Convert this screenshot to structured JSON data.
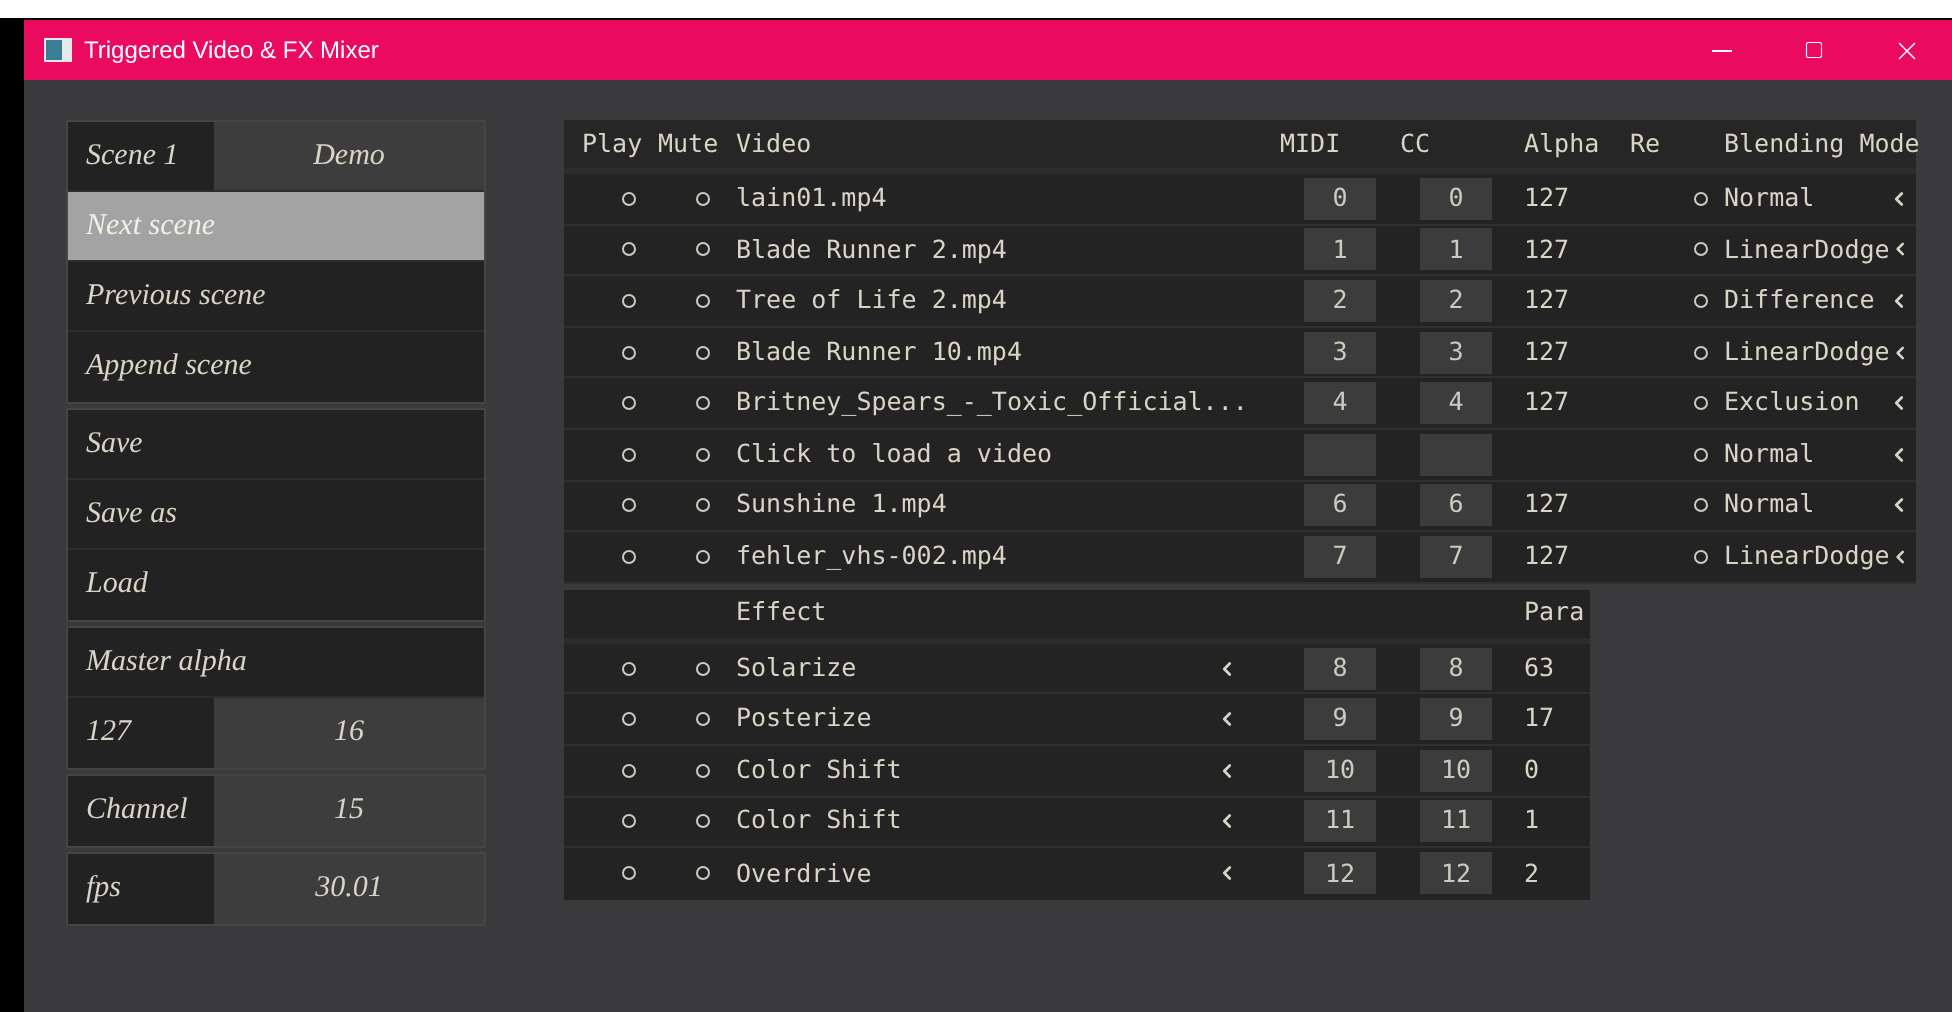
{
  "window": {
    "title": "Triggered Video & FX Mixer"
  },
  "scene_panel": {
    "groups": [
      {
        "items": [
          {
            "kind": "pair",
            "label": "Scene 1",
            "value": "Demo"
          },
          {
            "kind": "button",
            "label": "Next scene",
            "highlighted": true
          },
          {
            "kind": "button",
            "label": "Previous scene",
            "highlighted": false
          },
          {
            "kind": "button",
            "label": "Append scene",
            "highlighted": false
          }
        ]
      },
      {
        "items": [
          {
            "kind": "button",
            "label": "Save",
            "highlighted": false
          },
          {
            "kind": "button",
            "label": "Save as",
            "highlighted": false
          },
          {
            "kind": "button",
            "label": "Load",
            "highlighted": false
          }
        ]
      },
      {
        "items": [
          {
            "kind": "label",
            "label": "Master alpha"
          },
          {
            "kind": "pair",
            "label": "127",
            "value": "16"
          }
        ]
      },
      {
        "items": [
          {
            "kind": "pair",
            "label": "Channel",
            "value": "15"
          }
        ]
      },
      {
        "items": [
          {
            "kind": "pair",
            "label": "fps",
            "value": "30.01"
          }
        ]
      }
    ]
  },
  "video_table": {
    "columns": [
      "Play",
      "Mute",
      "Video",
      "MIDI",
      "CC",
      "Alpha",
      "Re",
      "Blending Mode"
    ],
    "rows": [
      {
        "playing": false,
        "muted": false,
        "video": "lain01.mp4",
        "midi": "0",
        "cc": "0",
        "alpha": "127",
        "re": false,
        "blend": "Normal"
      },
      {
        "playing": false,
        "muted": false,
        "video": "Blade Runner 2.mp4",
        "midi": "1",
        "cc": "1",
        "alpha": "127",
        "re": false,
        "blend": "LinearDodge"
      },
      {
        "playing": false,
        "muted": false,
        "video": "Tree of Life 2.mp4",
        "midi": "2",
        "cc": "2",
        "alpha": "127",
        "re": false,
        "blend": "Difference"
      },
      {
        "playing": false,
        "muted": false,
        "video": "Blade Runner 10.mp4",
        "midi": "3",
        "cc": "3",
        "alpha": "127",
        "re": false,
        "blend": "LinearDodge"
      },
      {
        "playing": false,
        "muted": false,
        "video": "Britney_Spears_-_Toxic_Official...",
        "midi": "4",
        "cc": "4",
        "alpha": "127",
        "re": false,
        "blend": "Exclusion"
      },
      {
        "playing": false,
        "muted": false,
        "video": "Click to load a video",
        "re": false,
        "blend": "Normal"
      },
      {
        "playing": false,
        "muted": false,
        "video": "Sunshine 1.mp4",
        "midi": "6",
        "cc": "6",
        "alpha": "127",
        "re": false,
        "blend": "Normal"
      },
      {
        "playing": false,
        "muted": false,
        "video": "fehler_vhs-002.mp4",
        "midi": "7",
        "cc": "7",
        "alpha": "127",
        "re": false,
        "blend": "LinearDodge"
      }
    ]
  },
  "effect_table": {
    "columns": [
      "Effect",
      "Para"
    ],
    "rows": [
      {
        "playing": false,
        "muted": false,
        "effect": "Solarize",
        "midi": "8",
        "cc": "8",
        "para": "63"
      },
      {
        "playing": false,
        "muted": false,
        "effect": "Posterize",
        "midi": "9",
        "cc": "9",
        "para": "17"
      },
      {
        "playing": false,
        "muted": false,
        "effect": "Color Shift",
        "midi": "10",
        "cc": "10",
        "para": "0"
      },
      {
        "playing": false,
        "muted": false,
        "effect": "Color Shift",
        "midi": "11",
        "cc": "11",
        "para": "1"
      },
      {
        "playing": false,
        "muted": false,
        "effect": "Overdrive",
        "midi": "12",
        "cc": "12",
        "para": "2"
      }
    ]
  }
}
